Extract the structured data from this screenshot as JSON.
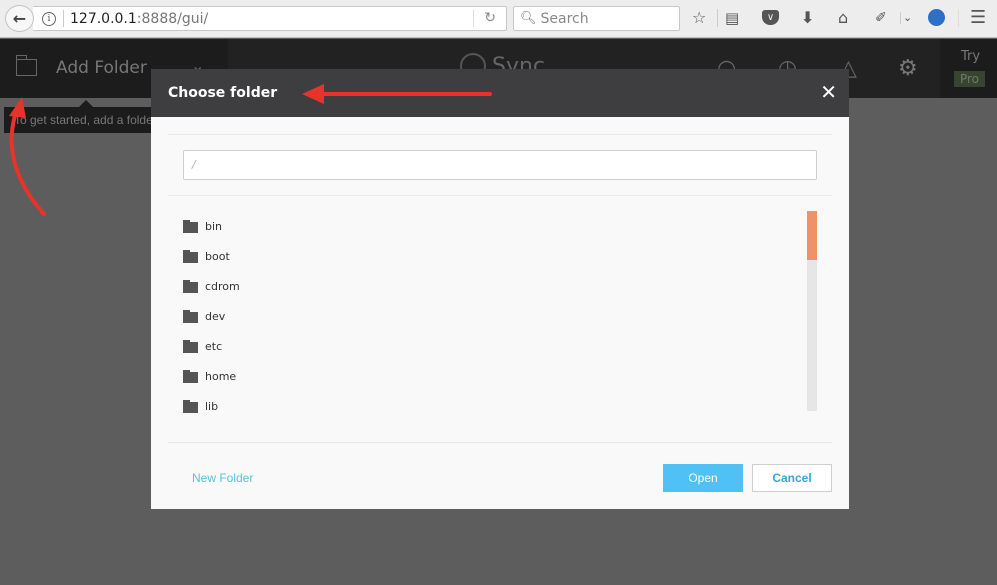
{
  "browser": {
    "url_host": "127.0.0.1",
    "url_rest": ":8888/gui/",
    "search_placeholder": "Search",
    "icons": [
      "back-arrow-icon",
      "info-icon",
      "reload-icon",
      "search-icon",
      "bookmark-star-icon",
      "reading-list-icon",
      "pocket-icon",
      "download-icon",
      "home-icon",
      "eyedropper-icon",
      "chevron-down-icon",
      "profile-globe-icon",
      "hamburger-menu-icon"
    ]
  },
  "app_header": {
    "add_folder_label": "Add Folder",
    "logo_text": "Sync",
    "try_label": "Try",
    "pro_label": "Pro"
  },
  "tooltip": {
    "text": "To get started, add a folder"
  },
  "modal": {
    "title": "Choose folder",
    "path_value": "/",
    "folders": [
      "bin",
      "boot",
      "cdrom",
      "dev",
      "etc",
      "home",
      "lib"
    ],
    "scroll_position": 0.0,
    "new_folder_label": "New Folder",
    "open_label": "Open",
    "cancel_label": "Cancel"
  },
  "colors": {
    "accent_orange": "#f09268",
    "primary_blue": "#4fc1f4",
    "link_blue": "#5bc0de",
    "annotation_red": "#e8322c"
  }
}
